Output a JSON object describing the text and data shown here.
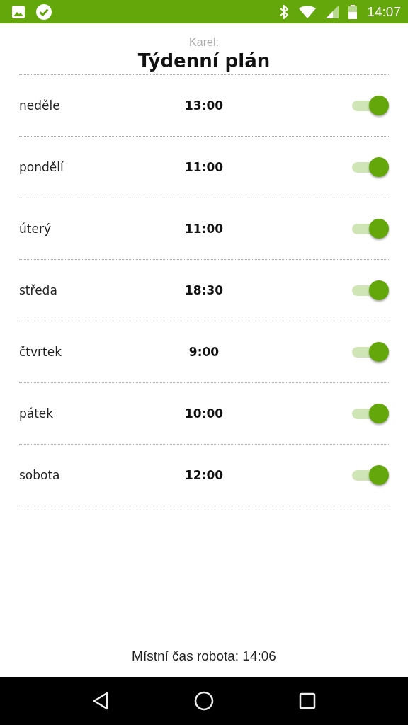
{
  "status_bar": {
    "time": "14:07"
  },
  "header": {
    "subtitle": "Karel:",
    "title": "Týdenní plán"
  },
  "days": [
    {
      "day": "neděle",
      "time": "13:00",
      "on": true
    },
    {
      "day": "pondělí",
      "time": "11:00",
      "on": true
    },
    {
      "day": "úterý",
      "time": "11:00",
      "on": true
    },
    {
      "day": "středa",
      "time": "18:30",
      "on": true
    },
    {
      "day": "čtvrtek",
      "time": "9:00",
      "on": true
    },
    {
      "day": "pátek",
      "time": "10:00",
      "on": true
    },
    {
      "day": "sobota",
      "time": "12:00",
      "on": true
    }
  ],
  "footer": "Místní čas robota: 14:06"
}
